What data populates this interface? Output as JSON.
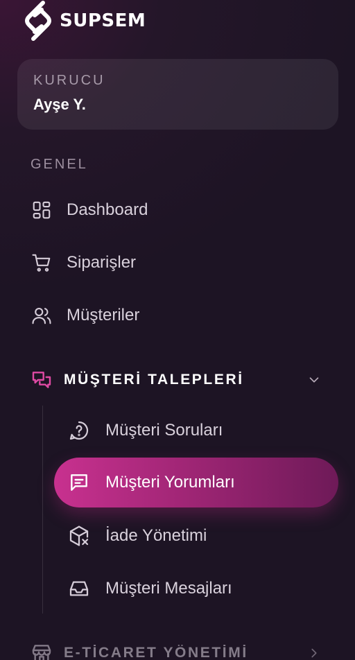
{
  "brand": {
    "name": "SUPSEM"
  },
  "user": {
    "role": "KURUCU",
    "name": "Ayşe Y."
  },
  "sections": {
    "general_label": "GENEL"
  },
  "nav": {
    "dashboard": "Dashboard",
    "orders": "Siparişler",
    "customers": "Müşteriler"
  },
  "customer_requests": {
    "title": "MÜŞTERİ TALEPLERİ",
    "items": [
      {
        "label": "Müşteri Soruları",
        "icon": "question-chat-icon"
      },
      {
        "label": "Müşteri Yorumları",
        "icon": "message-square-icon",
        "active": true
      },
      {
        "label": "İade Yönetimi",
        "icon": "package-x-icon"
      },
      {
        "label": "Müşteri Mesajları",
        "icon": "inbox-icon"
      }
    ]
  },
  "ecommerce": {
    "title": "E-TİCARET YÖNETİMİ"
  },
  "colors": {
    "accent": "#c8318f",
    "group_icon": "#e04aa4",
    "background": "#1d1424"
  }
}
